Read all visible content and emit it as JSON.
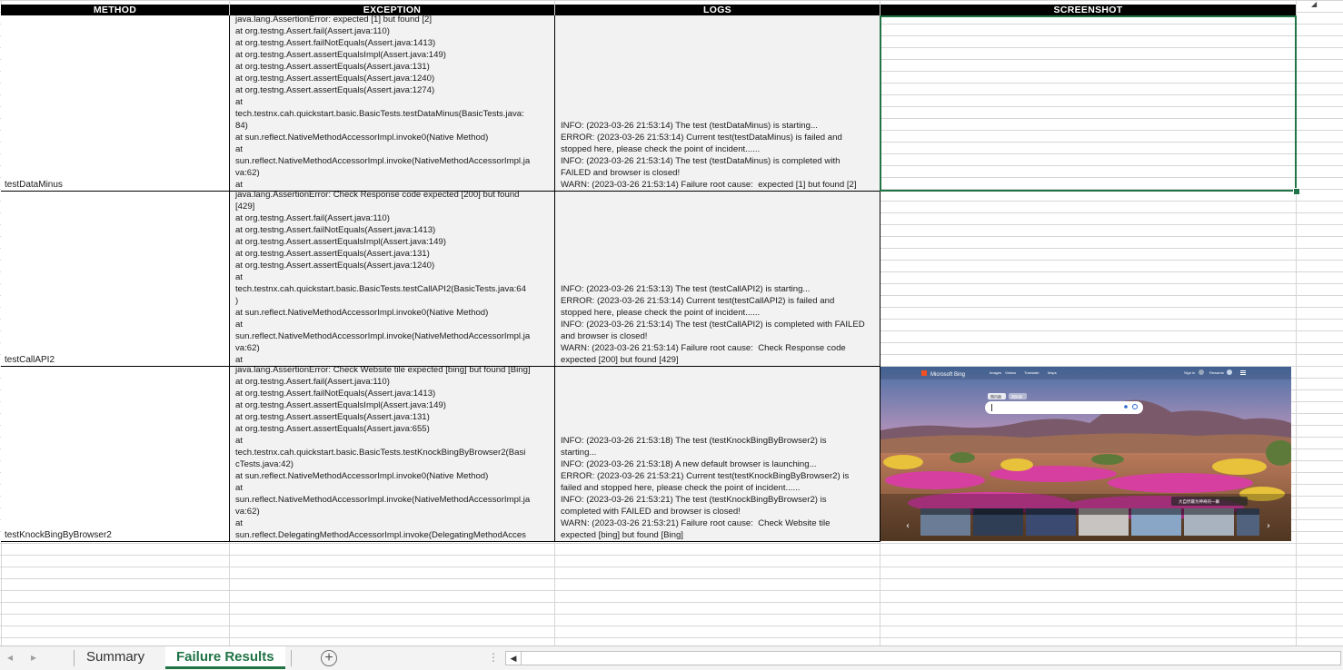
{
  "columns": {
    "method": "METHOD",
    "exception": "EXCEPTION",
    "logs": "LOGS",
    "screenshot": "SCREENSHOT"
  },
  "rows": [
    {
      "method": "testDataMinus",
      "exception": "java.lang.AssertionError: expected [1] but found [2]\nat org.testng.Assert.fail(Assert.java:110)\nat org.testng.Assert.failNotEquals(Assert.java:1413)\nat org.testng.Assert.assertEqualsImpl(Assert.java:149)\nat org.testng.Assert.assertEquals(Assert.java:131)\nat org.testng.Assert.assertEquals(Assert.java:1240)\nat org.testng.Assert.assertEquals(Assert.java:1274)\nat\ntech.testnx.cah.quickstart.basic.BasicTests.testDataMinus(BasicTests.java:\n84)\nat sun.reflect.NativeMethodAccessorImpl.invoke0(Native Method)\nat\nsun.reflect.NativeMethodAccessorImpl.invoke(NativeMethodAccessorImpl.ja\nva:62)\nat",
      "logs": "INFO: (2023-03-26 21:53:14) The test (testDataMinus) is starting...\nERROR: (2023-03-26 21:53:14) Current test(testDataMinus) is failed and\nstopped here, please check the point of incident......\nINFO: (2023-03-26 21:53:14) The test (testDataMinus) is completed with\nFAILED and browser is closed!\nWARN: (2023-03-26 21:53:14) Failure root cause:  expected [1] but found [2]"
    },
    {
      "method": "testCallAPI2",
      "exception": "java.lang.AssertionError: Check Response code expected [200] but found\n[429]\nat org.testng.Assert.fail(Assert.java:110)\nat org.testng.Assert.failNotEquals(Assert.java:1413)\nat org.testng.Assert.assertEqualsImpl(Assert.java:149)\nat org.testng.Assert.assertEquals(Assert.java:131)\nat org.testng.Assert.assertEquals(Assert.java:1240)\nat\ntech.testnx.cah.quickstart.basic.BasicTests.testCallAPI2(BasicTests.java:64\n)\nat sun.reflect.NativeMethodAccessorImpl.invoke0(Native Method)\nat\nsun.reflect.NativeMethodAccessorImpl.invoke(NativeMethodAccessorImpl.ja\nva:62)\nat",
      "logs": "INFO: (2023-03-26 21:53:13) The test (testCallAPI2) is starting...\nERROR: (2023-03-26 21:53:14) Current test(testCallAPI2) is failed and\nstopped here, please check the point of incident......\nINFO: (2023-03-26 21:53:14) The test (testCallAPI2) is completed with FAILED\nand browser is closed!\nWARN: (2023-03-26 21:53:14) Failure root cause:  Check Response code\nexpected [200] but found [429]"
    },
    {
      "method": "testKnockBingByBrowser2",
      "exception": "java.lang.AssertionError: Check Website tile expected [bing] but found [Bing]\nat org.testng.Assert.fail(Assert.java:110)\nat org.testng.Assert.failNotEquals(Assert.java:1413)\nat org.testng.Assert.assertEqualsImpl(Assert.java:149)\nat org.testng.Assert.assertEquals(Assert.java:131)\nat org.testng.Assert.assertEquals(Assert.java:655)\nat\ntech.testnx.cah.quickstart.basic.BasicTests.testKnockBingByBrowser2(Basi\ncTests.java:42)\nat sun.reflect.NativeMethodAccessorImpl.invoke0(Native Method)\nat\nsun.reflect.NativeMethodAccessorImpl.invoke(NativeMethodAccessorImpl.ja\nva:62)\nat\nsun.reflect.DelegatingMethodAccessorImpl.invoke(DelegatingMethodAcces",
      "logs": "INFO: (2023-03-26 21:53:18) The test (testKnockBingByBrowser2) is\nstarting...\nINFO: (2023-03-26 21:53:18) A new default browser is launching...\nERROR: (2023-03-26 21:53:21) Current test(testKnockBingByBrowser2) is\nfailed and stopped here, please check the point of incident......\nINFO: (2023-03-26 21:53:21) The test (testKnockBingByBrowser2) is\ncompleted with FAILED and browser is closed!\nWARN: (2023-03-26 21:53:21) Failure root cause:  Check Website tile\nexpected [bing] but found [Bing]"
    }
  ],
  "screenshot_image": {
    "brand": "Microsoft Bing",
    "nav": [
      "Images",
      "Videos",
      "Translate",
      "Maps"
    ],
    "signin": "Sign in",
    "rewards": "Rewards",
    "chips": [
      "国内版",
      "国际版"
    ],
    "caption": "大自然最为神奇的一幕"
  },
  "sheet_tabs": {
    "summary": "Summary",
    "failure_results": "Failure Results"
  },
  "colors": {
    "header_bg": "#000000",
    "accent_green": "#217346",
    "cell_fill": "#f2f2f2"
  }
}
